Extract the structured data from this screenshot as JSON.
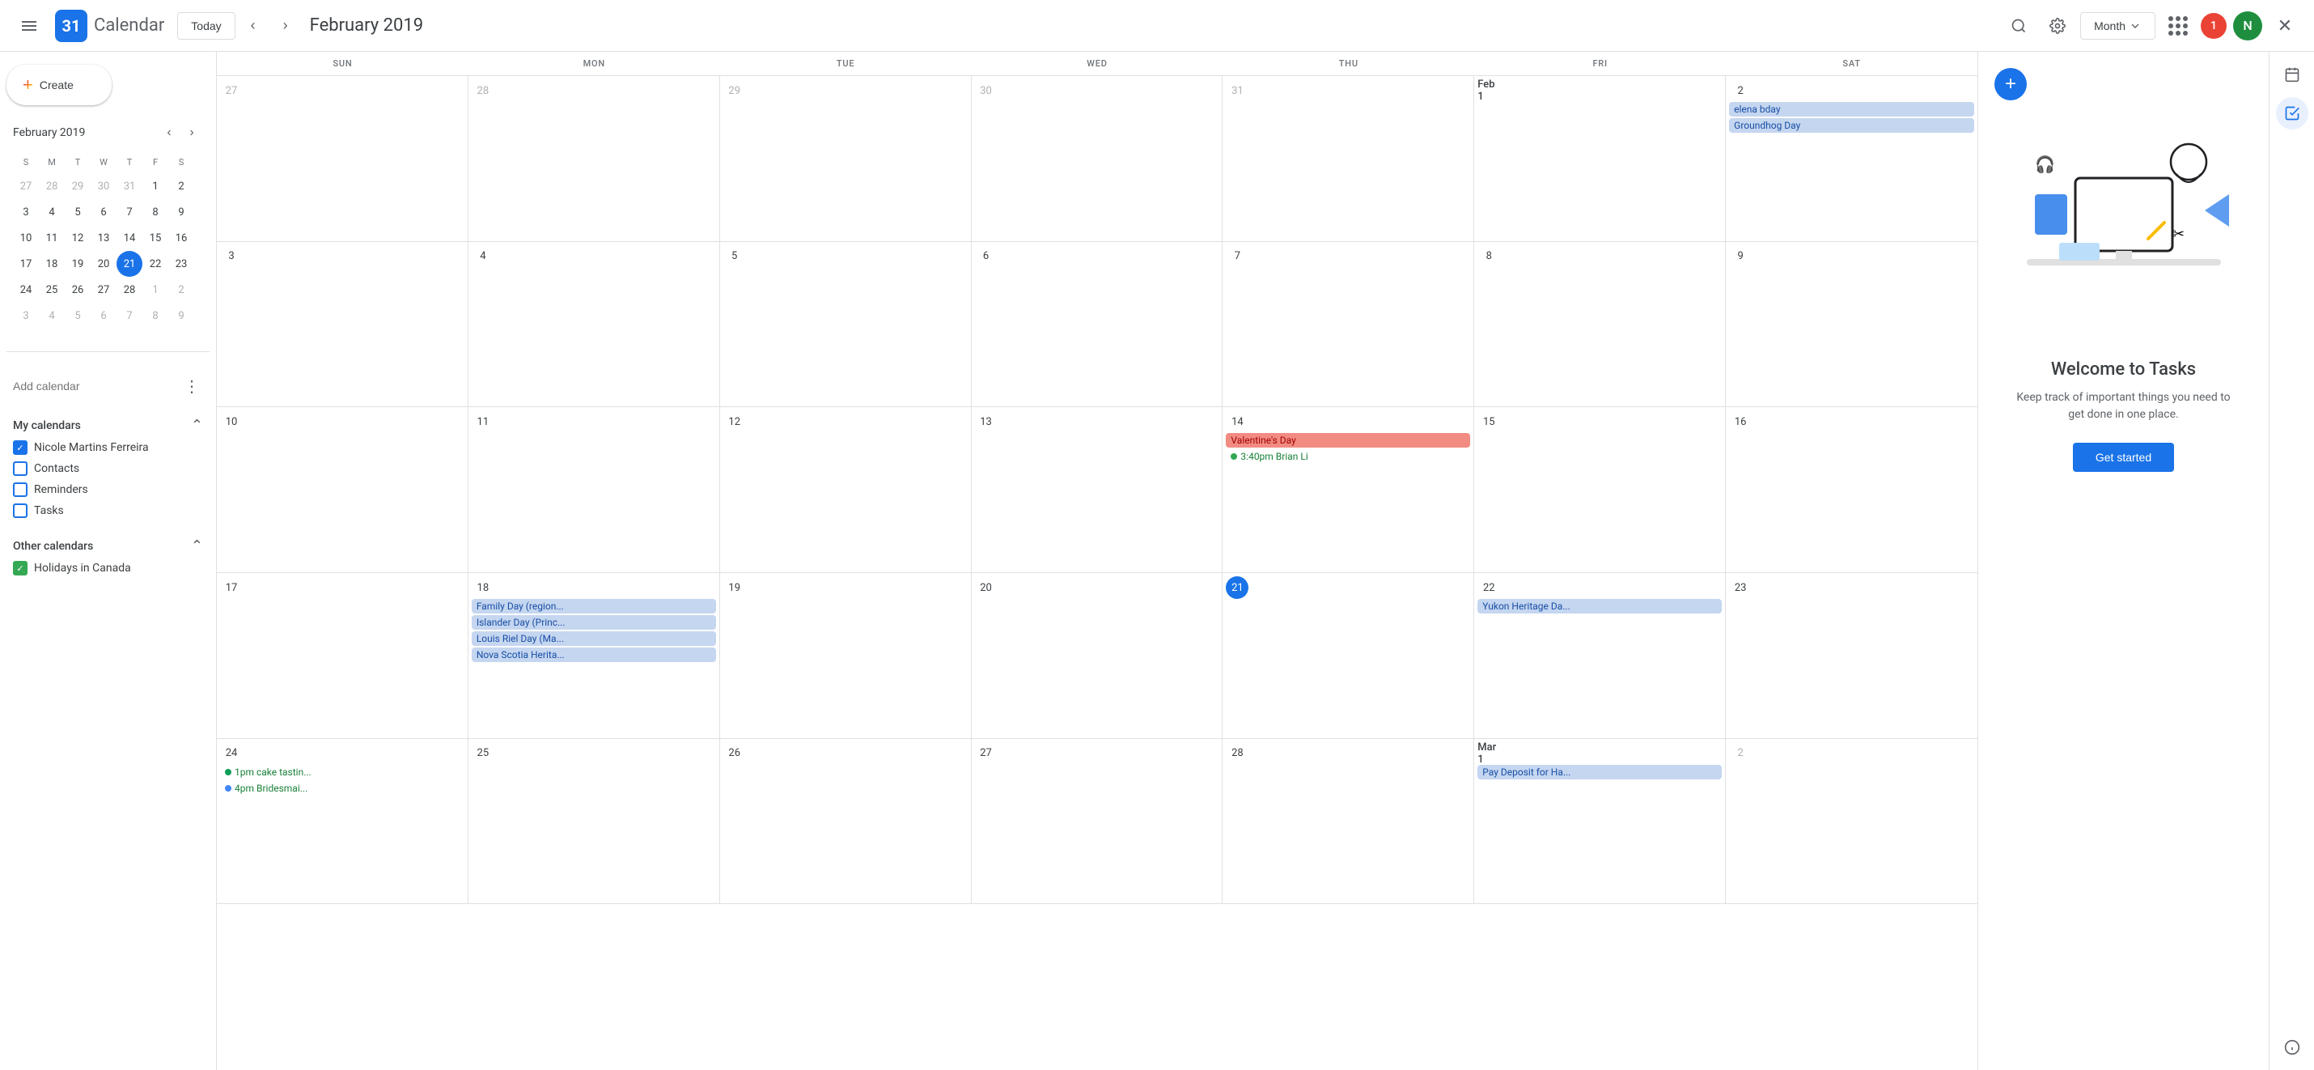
{
  "topbar": {
    "app_name": "Calendar",
    "logo_num": "31",
    "today_label": "Today",
    "current_month": "February 2019",
    "view_label": "Month",
    "notification_count": "1",
    "avatar_letter": "N"
  },
  "sidebar": {
    "create_label": "Create",
    "mini_cal": {
      "title": "February 2019",
      "days_of_week": [
        "S",
        "M",
        "T",
        "W",
        "T",
        "F",
        "S"
      ],
      "weeks": [
        [
          {
            "num": "27",
            "type": "other"
          },
          {
            "num": "28",
            "type": "other"
          },
          {
            "num": "29",
            "type": "other"
          },
          {
            "num": "30",
            "type": "other"
          },
          {
            "num": "31",
            "type": "other"
          },
          {
            "num": "1",
            "type": "normal"
          },
          {
            "num": "2",
            "type": "normal"
          }
        ],
        [
          {
            "num": "3",
            "type": "normal"
          },
          {
            "num": "4",
            "type": "normal"
          },
          {
            "num": "5",
            "type": "normal"
          },
          {
            "num": "6",
            "type": "normal"
          },
          {
            "num": "7",
            "type": "normal"
          },
          {
            "num": "8",
            "type": "normal"
          },
          {
            "num": "9",
            "type": "normal"
          }
        ],
        [
          {
            "num": "10",
            "type": "normal"
          },
          {
            "num": "11",
            "type": "normal"
          },
          {
            "num": "12",
            "type": "normal"
          },
          {
            "num": "13",
            "type": "normal"
          },
          {
            "num": "14",
            "type": "normal"
          },
          {
            "num": "15",
            "type": "normal"
          },
          {
            "num": "16",
            "type": "normal"
          }
        ],
        [
          {
            "num": "17",
            "type": "normal"
          },
          {
            "num": "18",
            "type": "normal"
          },
          {
            "num": "19",
            "type": "normal"
          },
          {
            "num": "20",
            "type": "normal"
          },
          {
            "num": "21",
            "type": "today"
          },
          {
            "num": "22",
            "type": "normal"
          },
          {
            "num": "23",
            "type": "normal"
          }
        ],
        [
          {
            "num": "24",
            "type": "normal"
          },
          {
            "num": "25",
            "type": "normal"
          },
          {
            "num": "26",
            "type": "normal"
          },
          {
            "num": "27",
            "type": "normal"
          },
          {
            "num": "28",
            "type": "normal"
          },
          {
            "num": "1",
            "type": "other"
          },
          {
            "num": "2",
            "type": "other"
          }
        ],
        [
          {
            "num": "3",
            "type": "other"
          },
          {
            "num": "4",
            "type": "other"
          },
          {
            "num": "5",
            "type": "other"
          },
          {
            "num": "6",
            "type": "other"
          },
          {
            "num": "7",
            "type": "other"
          },
          {
            "num": "8",
            "type": "other"
          },
          {
            "num": "9",
            "type": "other"
          }
        ]
      ]
    },
    "add_calendar_placeholder": "Add calendar",
    "my_calendars_label": "My calendars",
    "my_calendars": [
      {
        "label": "Nicole Martins Ferreira",
        "checked": true,
        "color": "#1a73e8"
      },
      {
        "label": "Contacts",
        "checked": false,
        "color": "#1a73e8"
      },
      {
        "label": "Reminders",
        "checked": false,
        "color": "#1a73e8"
      },
      {
        "label": "Tasks",
        "checked": false,
        "color": "#1a73e8"
      }
    ],
    "other_calendars_label": "Other calendars",
    "other_calendars": [
      {
        "label": "Holidays in Canada",
        "checked": true,
        "color": "#34a853"
      }
    ]
  },
  "calendar": {
    "days_of_week": [
      "SUN",
      "MON",
      "TUE",
      "WED",
      "THU",
      "FRI",
      "SAT"
    ],
    "weeks": [
      {
        "days": [
          {
            "num": "27",
            "type": "other",
            "events": []
          },
          {
            "num": "28",
            "type": "other",
            "events": []
          },
          {
            "num": "29",
            "type": "other",
            "events": []
          },
          {
            "num": "30",
            "type": "other",
            "events": []
          },
          {
            "num": "31",
            "type": "other",
            "events": []
          },
          {
            "num": "Feb 1",
            "type": "named",
            "events": []
          },
          {
            "num": "2",
            "type": "normal",
            "events": [
              {
                "label": "elena bday",
                "style": "blue-bg"
              },
              {
                "label": "Groundhog Day",
                "style": "blue-bg"
              }
            ]
          }
        ]
      },
      {
        "days": [
          {
            "num": "3",
            "type": "normal",
            "events": []
          },
          {
            "num": "4",
            "type": "normal",
            "events": []
          },
          {
            "num": "5",
            "type": "normal",
            "events": []
          },
          {
            "num": "6",
            "type": "normal",
            "events": []
          },
          {
            "num": "7",
            "type": "normal",
            "events": []
          },
          {
            "num": "8",
            "type": "normal",
            "events": []
          },
          {
            "num": "9",
            "type": "normal",
            "events": []
          }
        ]
      },
      {
        "days": [
          {
            "num": "10",
            "type": "normal",
            "events": []
          },
          {
            "num": "11",
            "type": "normal",
            "events": []
          },
          {
            "num": "12",
            "type": "normal",
            "events": []
          },
          {
            "num": "13",
            "type": "normal",
            "events": []
          },
          {
            "num": "14",
            "type": "normal",
            "events": [
              {
                "label": "Valentine's Day",
                "style": "red-bg"
              },
              {
                "label": "3:40pm Brian Li",
                "style": "green-outline",
                "dot": "green"
              }
            ]
          },
          {
            "num": "15",
            "type": "normal",
            "events": []
          },
          {
            "num": "16",
            "type": "normal",
            "events": []
          }
        ]
      },
      {
        "days": [
          {
            "num": "17",
            "type": "normal",
            "events": []
          },
          {
            "num": "18",
            "type": "normal",
            "events": [
              {
                "label": "Family Day (region...",
                "style": "blue-bg"
              },
              {
                "label": "Islander Day (Princ...",
                "style": "blue-bg"
              },
              {
                "label": "Louis Riel Day (Ma...",
                "style": "blue-bg"
              },
              {
                "label": "Nova Scotia Herita...",
                "style": "blue-bg"
              }
            ]
          },
          {
            "num": "19",
            "type": "normal",
            "events": []
          },
          {
            "num": "20",
            "type": "normal",
            "events": []
          },
          {
            "num": "21",
            "type": "today",
            "events": []
          },
          {
            "num": "22",
            "type": "normal",
            "events": [
              {
                "label": "Yukon Heritage Da...",
                "style": "blue-bg"
              }
            ]
          },
          {
            "num": "23",
            "type": "normal",
            "events": []
          }
        ]
      },
      {
        "days": [
          {
            "num": "24",
            "type": "normal",
            "events": [
              {
                "label": "1pm cake tastin...",
                "style": "green-outline",
                "dot": "teal"
              },
              {
                "label": "4pm Bridesmai...",
                "style": "green-outline",
                "dot": "blue"
              }
            ]
          },
          {
            "num": "25",
            "type": "normal",
            "events": []
          },
          {
            "num": "26",
            "type": "normal",
            "events": []
          },
          {
            "num": "27",
            "type": "normal",
            "events": []
          },
          {
            "num": "28",
            "type": "normal",
            "events": []
          },
          {
            "num": "Mar 1",
            "type": "named",
            "events": [
              {
                "label": "Pay Deposit for Ha...",
                "style": "blue-bg"
              }
            ]
          },
          {
            "num": "2",
            "type": "other",
            "events": []
          }
        ]
      }
    ]
  },
  "tasks_panel": {
    "welcome_title": "Welcome to Tasks",
    "welcome_desc": "Keep track of important things you need to get done in one place.",
    "get_started_label": "Get started",
    "add_label": "+"
  }
}
